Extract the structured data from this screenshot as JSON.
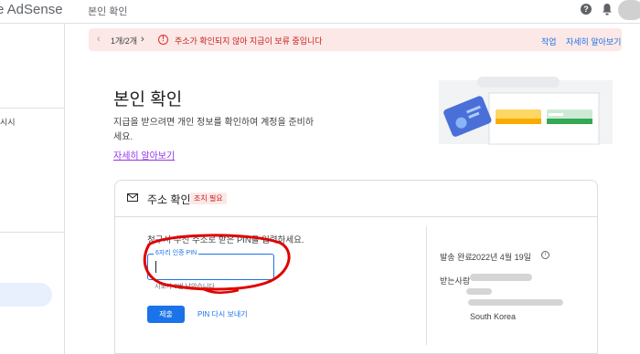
{
  "app": {
    "brand": "e AdSense",
    "page_name": "본인 확인"
  },
  "header": {
    "help_icon": "help-icon",
    "bell_icon": "bell-icon",
    "avatar_icon": "avatar"
  },
  "sidebar": {
    "item_text": "시시"
  },
  "alert": {
    "pager": "1개/2개",
    "message": "주소가 확인되지 않아 지급이 보류 중입니다",
    "action_primary": "작업",
    "action_secondary": "자세히 알아보기",
    "color": "#fce8e6"
  },
  "main": {
    "title": "본인 확인",
    "description": "지급을 받으려면 개인 정보를 확인하여 계정을 준비하세요.",
    "learn_more": "자세히 알아보기"
  },
  "card": {
    "title": "주소 확인",
    "badge": "조치 필요",
    "instruction": "청구서 수신 주소로 받은 PIN을 입력하세요.",
    "pin_label": "6자리 인증 PIN",
    "pin_value": "",
    "pin_hint": "시도가 3번 남았습니다",
    "submit_label": "제출",
    "resend_label": "PIN 다시 보내기",
    "sent_label": "발송 완료",
    "sent_date": "2022년 4월 19일",
    "recipient_label": "받는사람",
    "country": "South Korea"
  },
  "colors": {
    "accent": "#1a73e8",
    "error": "#d93025",
    "annotation": "#e00000"
  }
}
